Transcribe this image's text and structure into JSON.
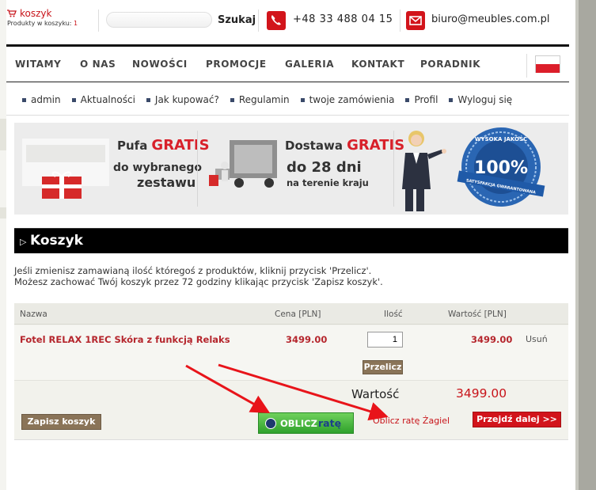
{
  "header": {
    "cart_label": "koszyk",
    "cart_items_label": "Produkty w koszyku:",
    "cart_items_count": "1",
    "search_placeholder": "",
    "search_button": "Szukaj",
    "phone": "+48 33 488 04 15",
    "email": "biuro@meubles.com.pl"
  },
  "main_nav": [
    "WITAMY",
    "O NAS",
    "NOWOŚCI",
    "PROMOCJE",
    "GALERIA",
    "KONTAKT",
    "PORADNIK"
  ],
  "sub_nav": [
    "admin",
    "Aktualności",
    "Jak kupować?",
    "Regulamin",
    "twoje zamówienia",
    "Profil",
    "Wyloguj się"
  ],
  "banner": {
    "promo1_line1_a": "Pufa",
    "promo1_line1_b": "GRATIS",
    "promo1_line2": "do wybranego",
    "promo1_line3": "zestawu",
    "promo2_line1_a": "Dostawa",
    "promo2_line1_b": "GRATIS",
    "promo2_line2": "do 28 dni",
    "promo2_line3": "na terenie kraju",
    "seal_top": "WYSOKA JAKOŚĆ",
    "seal_center": "100%",
    "seal_bottom": "SATYSFAKCJA GWARANTOWANA"
  },
  "section": {
    "title": "Koszyk",
    "intro_line1": "Jeśli zmienisz zamawianą ilość któregoś z produktów, kliknij przycisk 'Przelicz'.",
    "intro_line2": "Możesz zachować Twój koszyk przez 72 godziny klikając przycisk 'Zapisz koszyk'."
  },
  "cart": {
    "columns": {
      "name": "Nazwa",
      "price": "Cena [PLN]",
      "qty": "Ilość",
      "value": "Wartość [PLN]"
    },
    "items": [
      {
        "name": "Fotel RELAX 1REC Skóra z funkcją Relaks",
        "price": "3499.00",
        "qty": "1",
        "value": "3499.00",
        "remove": "Usuń"
      }
    ],
    "recalc_button": "Przelicz",
    "total_label": "Wartość",
    "total_value": "3499.00",
    "save_button": "Zapisz koszyk",
    "oblicz_button_a": "OBLICZ",
    "oblicz_button_b": "ratę",
    "zagiel_link": "Oblicz ratę Żagiel",
    "proceed_button": "Przejdź dalej >>"
  },
  "colors": {
    "accent_red": "#d2141b",
    "brown_button": "#8a7458",
    "green_button": "#3ab333"
  }
}
